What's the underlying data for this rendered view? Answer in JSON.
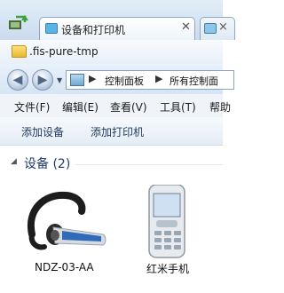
{
  "window": {
    "tab_active": "设备和打印机",
    "tab_close_glyph": "✕",
    "tab_inactive_close_glyph": "×"
  },
  "path_title": ".fis-pure-tmp",
  "navigation": {
    "back_glyph": "◀",
    "forward_glyph": "▶",
    "dropdown_glyph": "▼",
    "crumb_separator": "▶",
    "crumbs": [
      "控制面板",
      "所有控制面"
    ]
  },
  "menu": [
    "文件(F)",
    "编辑(E)",
    "查看(V)",
    "工具(T)",
    "帮助"
  ],
  "toolbar": {
    "add_device": "添加设备",
    "add_printer": "添加打印机"
  },
  "group": {
    "chevron": "◢",
    "title": "设备 (2)"
  },
  "devices": [
    {
      "label": "NDZ-03-AA",
      "icon": "bluetooth-headset-icon"
    },
    {
      "label": "红米手机",
      "icon": "mobile-phone-icon"
    }
  ],
  "colors": {
    "chrome_blue": "#d6e4f3",
    "group_title": "#1e3a6e",
    "toolbar_text": "#1e3a5f",
    "headset_body": "#1d1d1d",
    "headset_accent": "#2f6bb8"
  }
}
